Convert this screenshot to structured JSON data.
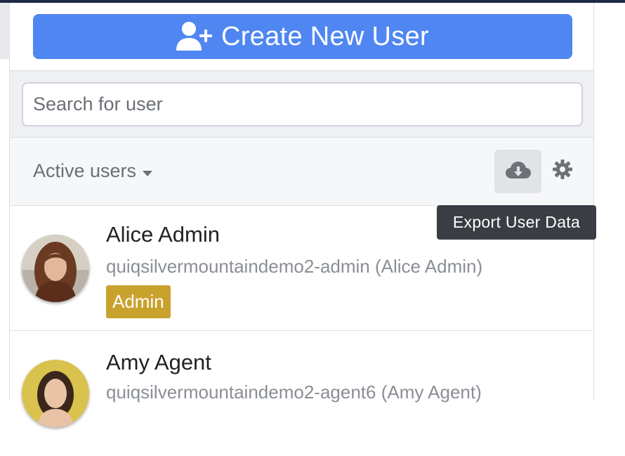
{
  "header": {
    "create_button_label": "Create New User",
    "create_icon": "user-plus-icon"
  },
  "search": {
    "placeholder": "Search for user",
    "value": ""
  },
  "filter": {
    "label": "Active users",
    "dropdown_icon": "caret-down-icon",
    "export_icon": "cloud-download-icon",
    "settings_icon": "gear-icon"
  },
  "tooltip": {
    "text": "Export User Data"
  },
  "users": [
    {
      "name": "Alice Admin",
      "subtitle": "quiqsilvermountaindemo2-admin (Alice Admin)",
      "role": "Admin"
    },
    {
      "name": "Amy Agent",
      "subtitle": "quiqsilvermountaindemo2-agent6 (Amy Agent)",
      "role": ""
    }
  ],
  "colors": {
    "primary": "#4f86f2",
    "admin_badge": "#c9a22e",
    "tooltip_bg": "#3b3d44",
    "top_bar": "#1e2a44"
  }
}
